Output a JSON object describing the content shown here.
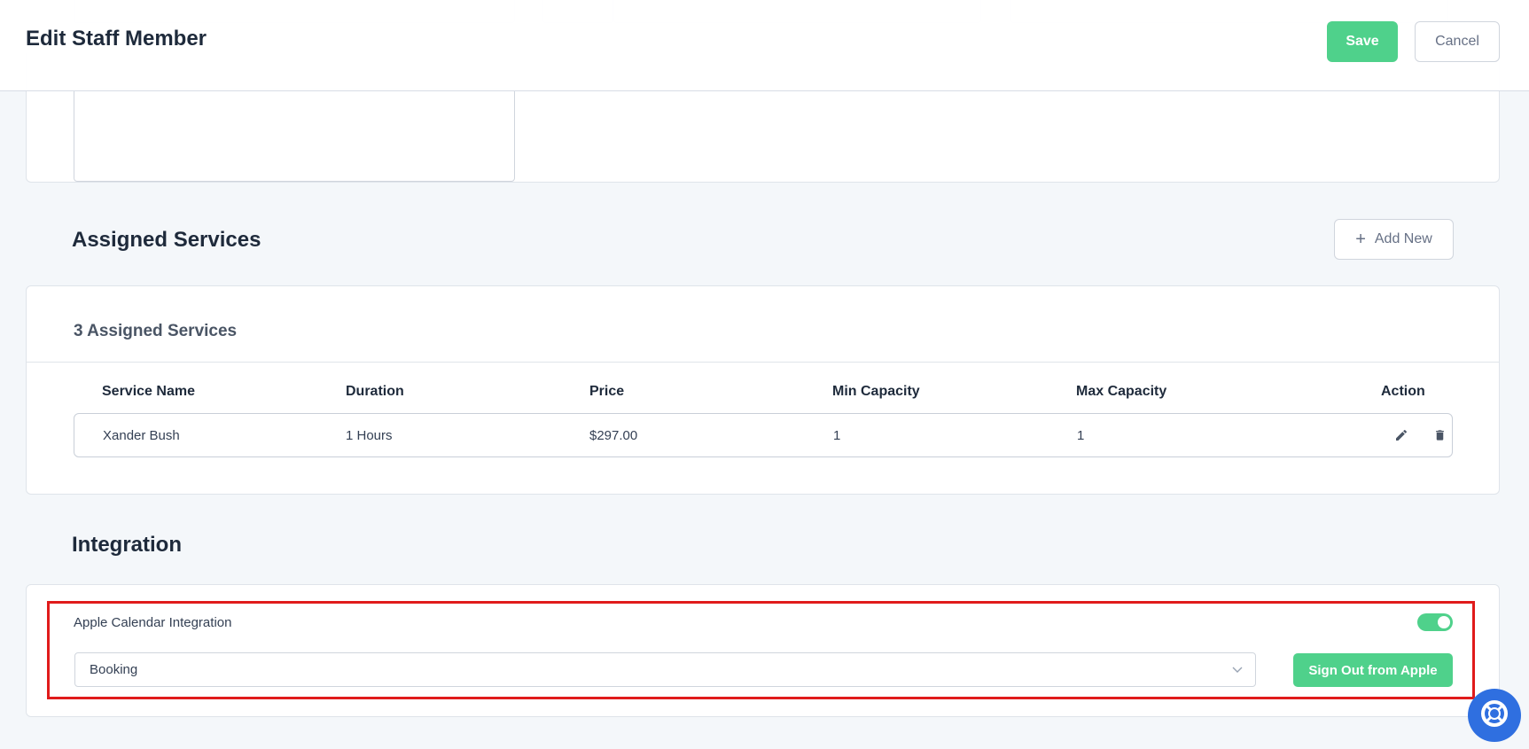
{
  "header": {
    "title": "Edit Staff Member",
    "save_label": "Save",
    "cancel_label": "Cancel"
  },
  "assigned_services": {
    "title": "Assigned Services",
    "add_new_label": "Add New",
    "count_label": "3 Assigned Services",
    "columns": [
      "Service Name",
      "Duration",
      "Price",
      "Min Capacity",
      "Max Capacity",
      "Action"
    ],
    "rows": [
      {
        "service_name": "Xander Bush",
        "duration": "1 Hours",
        "price": "$297.00",
        "min_capacity": "1",
        "max_capacity": "1"
      }
    ]
  },
  "integration": {
    "title": "Integration",
    "apple_label": "Apple Calendar Integration",
    "apple_enabled": true,
    "calendar_select_value": "Booking",
    "sign_out_label": "Sign Out from Apple"
  },
  "colors": {
    "accent_green": "#4fd18b",
    "highlight_red": "#e01b1b",
    "help_blue": "#2f6fe0"
  },
  "icons": [
    "plus-icon",
    "edit-pencil-icon",
    "trash-icon",
    "chevron-down-icon",
    "lifebuoy-icon"
  ]
}
